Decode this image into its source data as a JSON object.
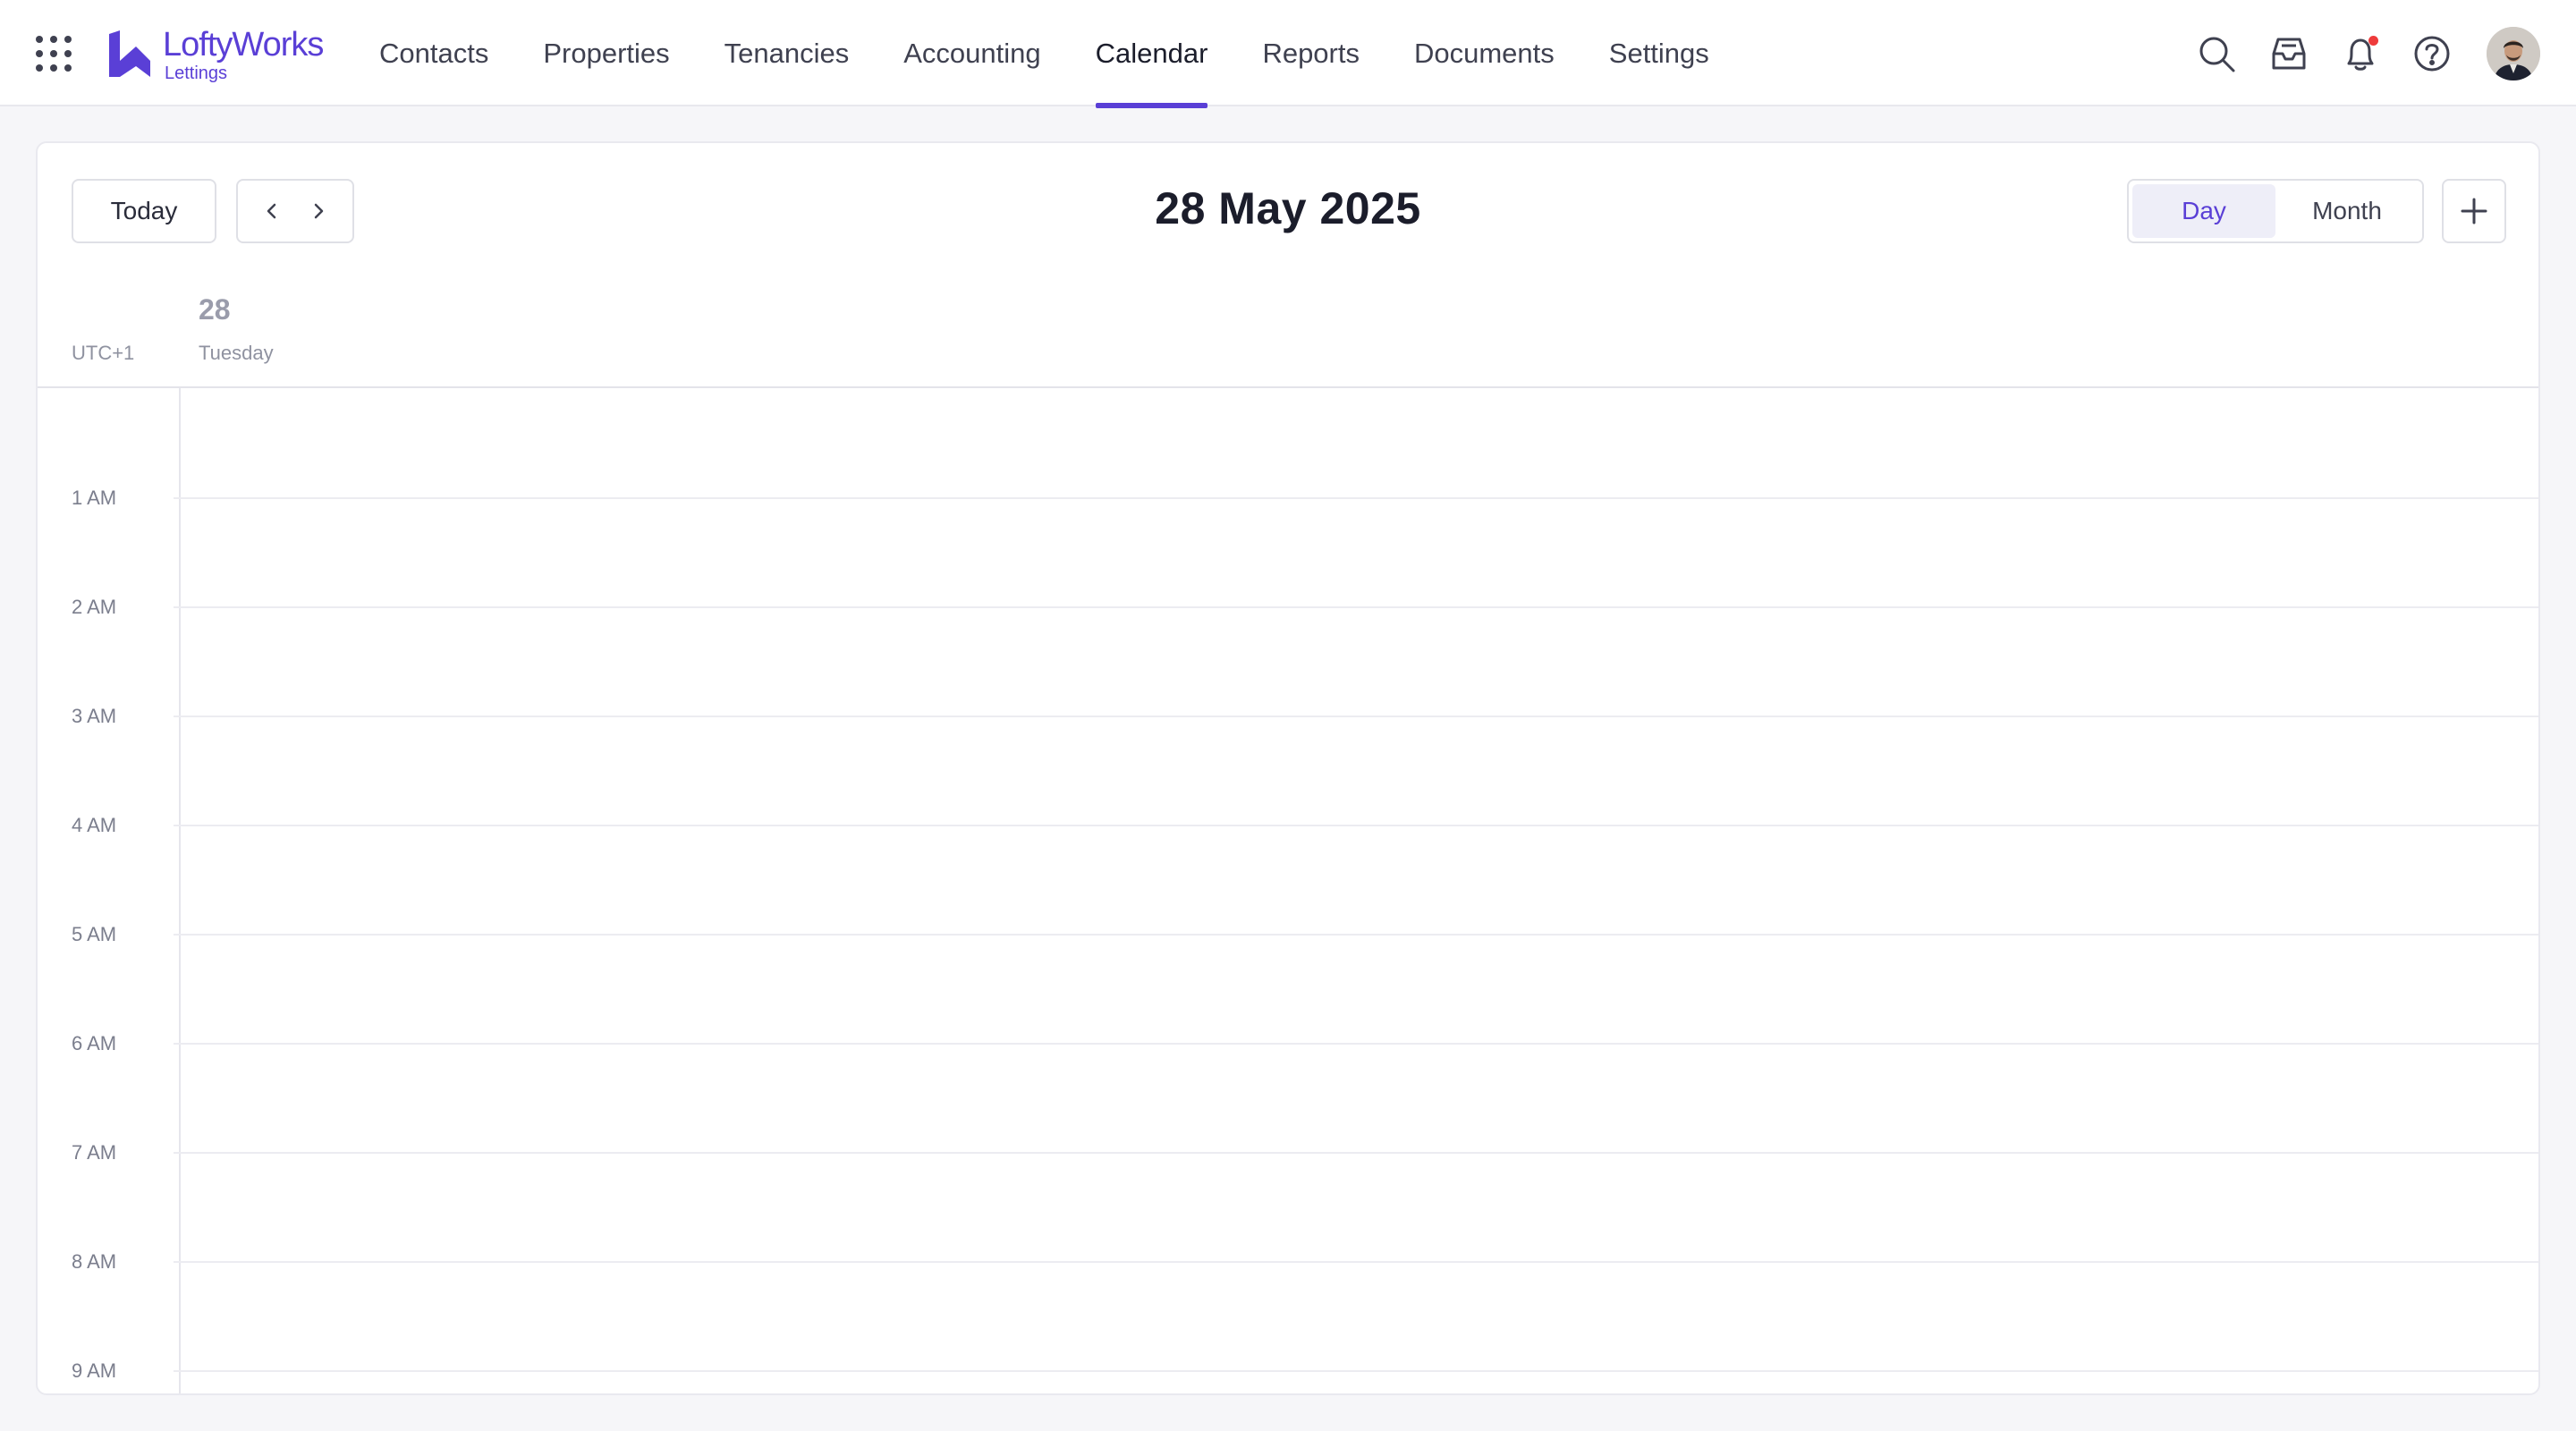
{
  "app": {
    "brand_primary": "LoftyWorks",
    "brand_secondary": "Lettings",
    "accent_color": "#5a3fd6"
  },
  "nav": {
    "items": [
      {
        "label": "Contacts"
      },
      {
        "label": "Properties"
      },
      {
        "label": "Tenancies"
      },
      {
        "label": "Accounting"
      },
      {
        "label": "Calendar",
        "active": true
      },
      {
        "label": "Reports"
      },
      {
        "label": "Documents"
      },
      {
        "label": "Settings"
      }
    ]
  },
  "header_icons": [
    "apps-grid-icon",
    "search-icon",
    "inbox-icon",
    "bell-icon",
    "help-icon",
    "user-avatar"
  ],
  "calendar": {
    "today_label": "Today",
    "title": "28 May 2025",
    "views": [
      {
        "label": "Day",
        "active": true
      },
      {
        "label": "Month",
        "active": false
      }
    ],
    "timezone": "UTC+1",
    "day_number": "28",
    "day_name": "Tuesday",
    "hours": [
      "1 AM",
      "2 AM",
      "3 AM",
      "4 AM",
      "5 AM",
      "6 AM",
      "7 AM",
      "8 AM",
      "9 AM"
    ]
  }
}
